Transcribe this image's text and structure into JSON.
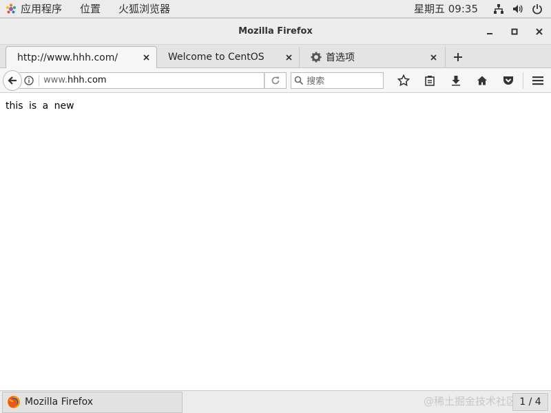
{
  "topbar": {
    "applications": "应用程序",
    "places": "位置",
    "firefox_menu": "火狐浏览器",
    "clock": "星期五 09:35",
    "icons": [
      "network-icon",
      "volume-icon",
      "power-icon"
    ]
  },
  "window": {
    "title": "Mozilla Firefox"
  },
  "tabs": [
    {
      "label": "http://www.hhh.com/",
      "active": true
    },
    {
      "label": "Welcome to CentOS",
      "active": false
    },
    {
      "label": "首选项",
      "active": false,
      "icon": "gear-icon"
    }
  ],
  "navbar": {
    "url_prefix": "www.",
    "url_domain": "hhh.com",
    "search_placeholder": "搜索"
  },
  "content": {
    "text": "this is a new"
  },
  "taskbar": {
    "window_item": "Mozilla Firefox",
    "watermark": "@稀土掘金技术社区",
    "workspace": "1 / 4"
  },
  "colors": {
    "topbar_bg": "#ececec",
    "titlebar_bg": "#ededed",
    "tabstrip_bg": "#e4e4e4"
  }
}
